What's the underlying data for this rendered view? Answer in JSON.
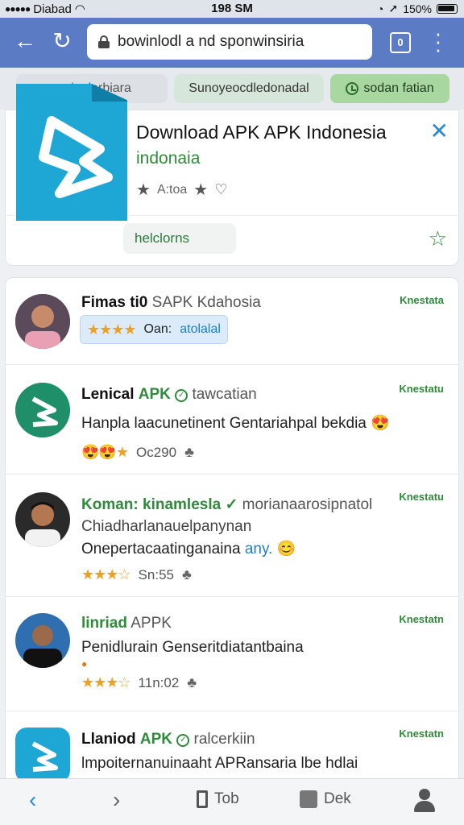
{
  "status_bar": {
    "carrier": "Diabad",
    "time": "198 SM",
    "battery": "150%"
  },
  "browser": {
    "url": "bowinlodl a nd sponwinsiria",
    "tab_count": "0"
  },
  "chips": [
    "ragis darbiara",
    "Sunoyeocdledonadal",
    "sodan fatian"
  ],
  "app_card": {
    "title": "Download APK APK Indonesia",
    "subtitle": "indonaia",
    "meta_text": "A:toa",
    "action_label": "helclorns"
  },
  "list": [
    {
      "name_bold": "Fimas ti0",
      "name_rest": "SAPK Kdahosia",
      "tag": "Knestata",
      "stars": "★★★★",
      "pill_left": "Oan:",
      "pill_right": "atolalal"
    },
    {
      "name_bold": "Lenical",
      "name_green": "APK",
      "name_rest": "tawcatian",
      "tag": "Knestatu",
      "line1": "Hanpla laacunetinent Gentariahpal bekdia 😍",
      "stars": "😍😍★",
      "rating_text": "Oc290"
    },
    {
      "name_green": "Koman: kinamlesla",
      "name_rest": "morianaarosipnatol",
      "tag": "Knestatu",
      "line1": "Chiadharlanauelpanynan",
      "line2": "Onepertacaatinganaina",
      "line2_tail": "any.",
      "stars": "★★★☆",
      "rating_text": "Sn:55"
    },
    {
      "name_green": "linriad",
      "name_rest": "APPK",
      "tag": "Knestatn",
      "line1": "Penidlurain Genseritdiatantbaina",
      "stars": "★★★☆",
      "rating_text": "11n:02"
    },
    {
      "name_bold": "Llaniod",
      "name_green": "APK",
      "name_rest": "ralcerkiin",
      "tag": "Knestatn",
      "line1": "lmpoiternanuinaaht APRansaria lbe hdlai"
    }
  ],
  "bottom_bar": {
    "tab_label": "Tob",
    "desk_label": "Dek"
  }
}
